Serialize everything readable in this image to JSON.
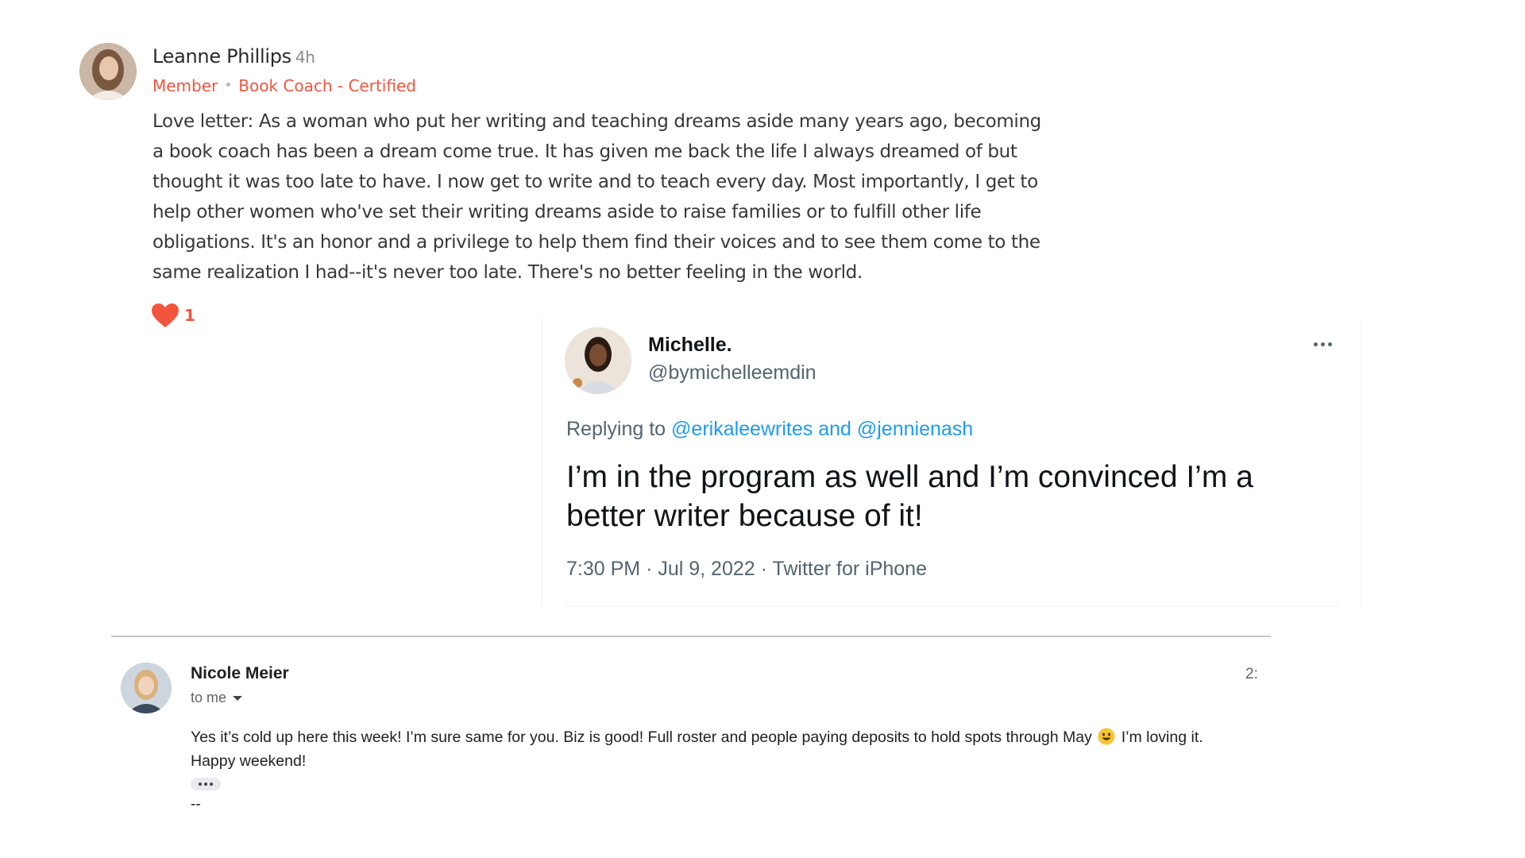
{
  "post": {
    "author": "Leanne Phillips",
    "time_ago": "4h",
    "roles": [
      "Member",
      "Book Coach - Certified"
    ],
    "body": "Love letter: As a woman who put her writing and teaching dreams aside many years ago, becoming a book coach has been a dream come true. It has given me back the life I always dreamed of but thought it was too late to have. I now get to write and to teach every day. Most importantly, I get to help other women who've set their writing dreams aside to raise families or to fulfill other life obligations. It's an honor and a privilege to help them find their voices and to see them come to the same realization I had--it's never too late. There's no better feeling in the world.",
    "reaction_count": "1",
    "reaction_icon": "heart-icon",
    "accent_color": "#f2553d"
  },
  "tweet": {
    "name": "Michelle.",
    "handle": "@bymichelleemdin",
    "replying_prefix": "Replying to",
    "reply_mention_1": "@erikaleewrites",
    "reply_and": "and",
    "reply_mention_2": "@jennienash",
    "text": "I’m in the program as well and I’m convinced I’m a better writer because of it!",
    "time": "7:30 PM",
    "date": "Jul 9, 2022",
    "source": "Twitter for iPhone",
    "separator": "·",
    "more_icon": "more-options-icon",
    "link_color": "#1d9bf0"
  },
  "email": {
    "sender": "Nicole Meier",
    "time_partial": "2:",
    "recipient": "to me",
    "body_part1": "Yes it’s cold up here this week! I’m sure same for you. Biz is good! Full roster and people paying deposits to hold spots through May",
    "emoji_icon": "smiley-face-icon",
    "body_part2": "I’m loving it.",
    "body_line2": "Happy weekend!",
    "signature": "--"
  }
}
